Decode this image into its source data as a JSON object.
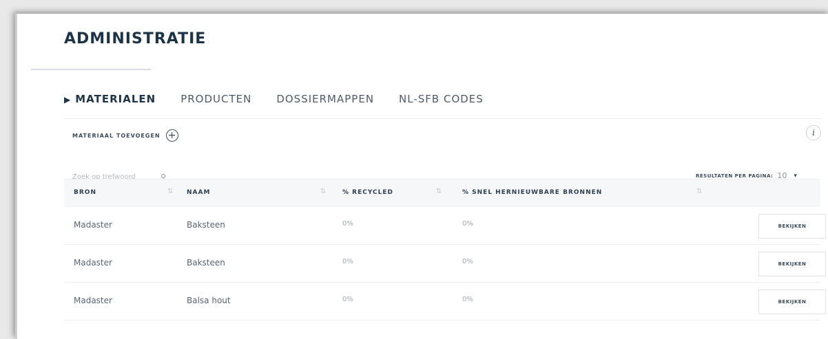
{
  "page": {
    "title": "ADMINISTRATIE"
  },
  "tabs": [
    {
      "label": "MATERIALEN",
      "active": true
    },
    {
      "label": "PRODUCTEN"
    },
    {
      "label": "DOSSIERMAPPEN"
    },
    {
      "label": "NL-SFB CODES"
    }
  ],
  "toolbar": {
    "add_label": "MATERIAAL TOEVOEGEN",
    "add_icon": "plus-circle-icon",
    "info_icon": "info-icon",
    "info_glyph": "i",
    "search_placeholder": "Zoek op trefwoord",
    "per_page_label": "RESULTATEN PER PAGINA:",
    "per_page_value": "10"
  },
  "table": {
    "columns": [
      "BRON",
      "NAAM",
      "% RECYCLED",
      "% SNEL HERNIEUWBARE BRONNEN"
    ],
    "rows": [
      {
        "bron": "Madaster",
        "naam": "Baksteen",
        "recycled": "0%",
        "snel": "0%",
        "action": "BEKIJKEN"
      },
      {
        "bron": "Madaster",
        "naam": "Baksteen",
        "recycled": "0%",
        "snel": "0%",
        "action": "BEKIJKEN"
      },
      {
        "bron": "Madaster",
        "naam": "Balsa hout",
        "recycled": "0%",
        "snel": "0%",
        "action": "BEKIJKEN"
      }
    ]
  }
}
